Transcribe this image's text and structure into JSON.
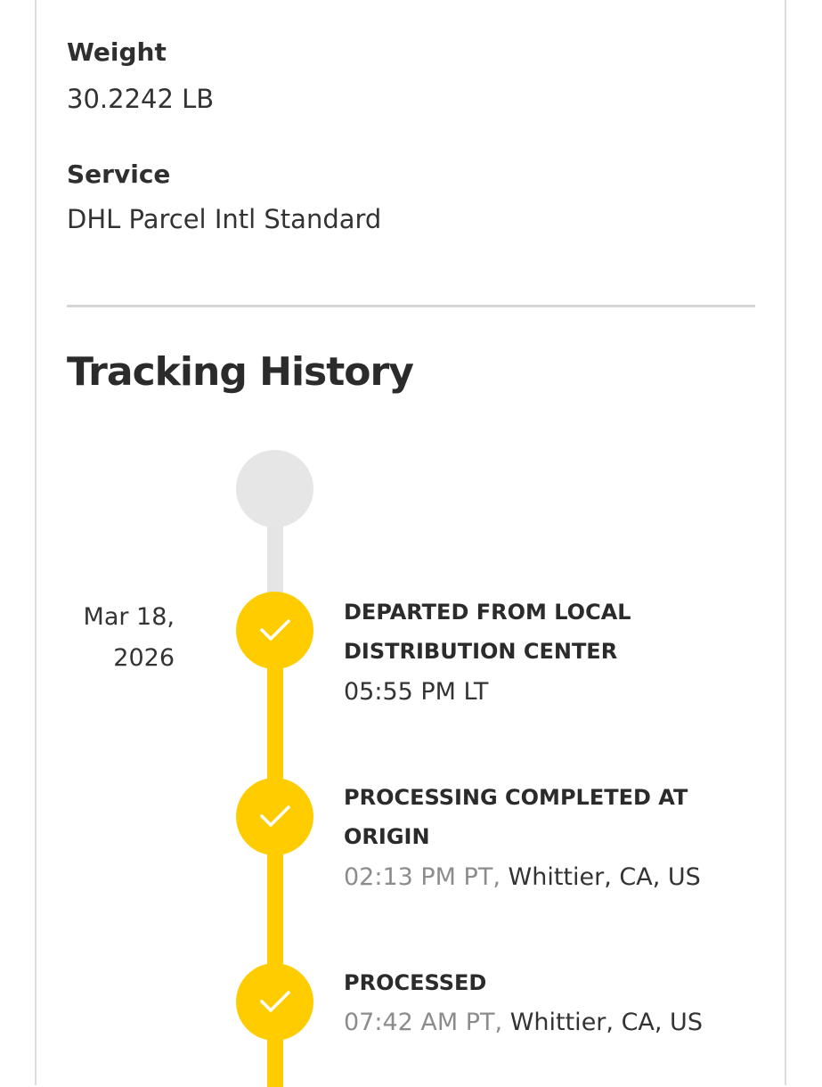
{
  "details": {
    "weight_label": "Weight",
    "weight_value": "30.2242 LB",
    "service_label": "Service",
    "service_value": "DHL Parcel Intl Standard"
  },
  "tracking": {
    "title": "Tracking History",
    "date_line1": "Mar 18,",
    "date_line2": "2026",
    "events": [
      {
        "title": "DEPARTED FROM LOCAL DISTRIBUTION CENTER",
        "time": "05:55 PM LT",
        "location": ""
      },
      {
        "title": "PROCESSING COMPLETED AT ORIGIN",
        "time": "02:13 PM PT,",
        "location": "Whittier, CA, US"
      },
      {
        "title": "PROCESSED",
        "time": "07:42 AM PT,",
        "location": "Whittier, CA, US"
      }
    ]
  },
  "colors": {
    "accent": "#ffcc00",
    "pending": "#e6e6e6",
    "muted_text": "#8c8c8c"
  },
  "icons": {
    "step_done": "checkmark-icon",
    "step_pending": "pending-step-icon"
  }
}
